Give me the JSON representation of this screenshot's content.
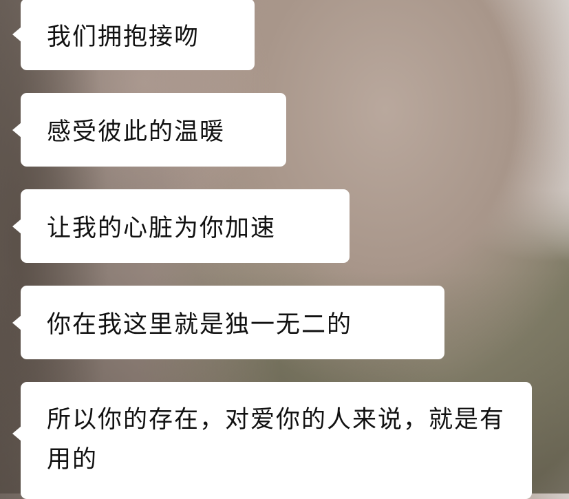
{
  "messages": [
    {
      "text": "我们拥抱接吻"
    },
    {
      "text": "感受彼此的温暖"
    },
    {
      "text": "让我的心脏为你加速"
    },
    {
      "text": "你在我这里就是独一无二的"
    },
    {
      "text": "所以你的存在，对爱你的人来说，就是有用的"
    }
  ],
  "colors": {
    "bubble": "#ffffff",
    "text": "#111111"
  }
}
